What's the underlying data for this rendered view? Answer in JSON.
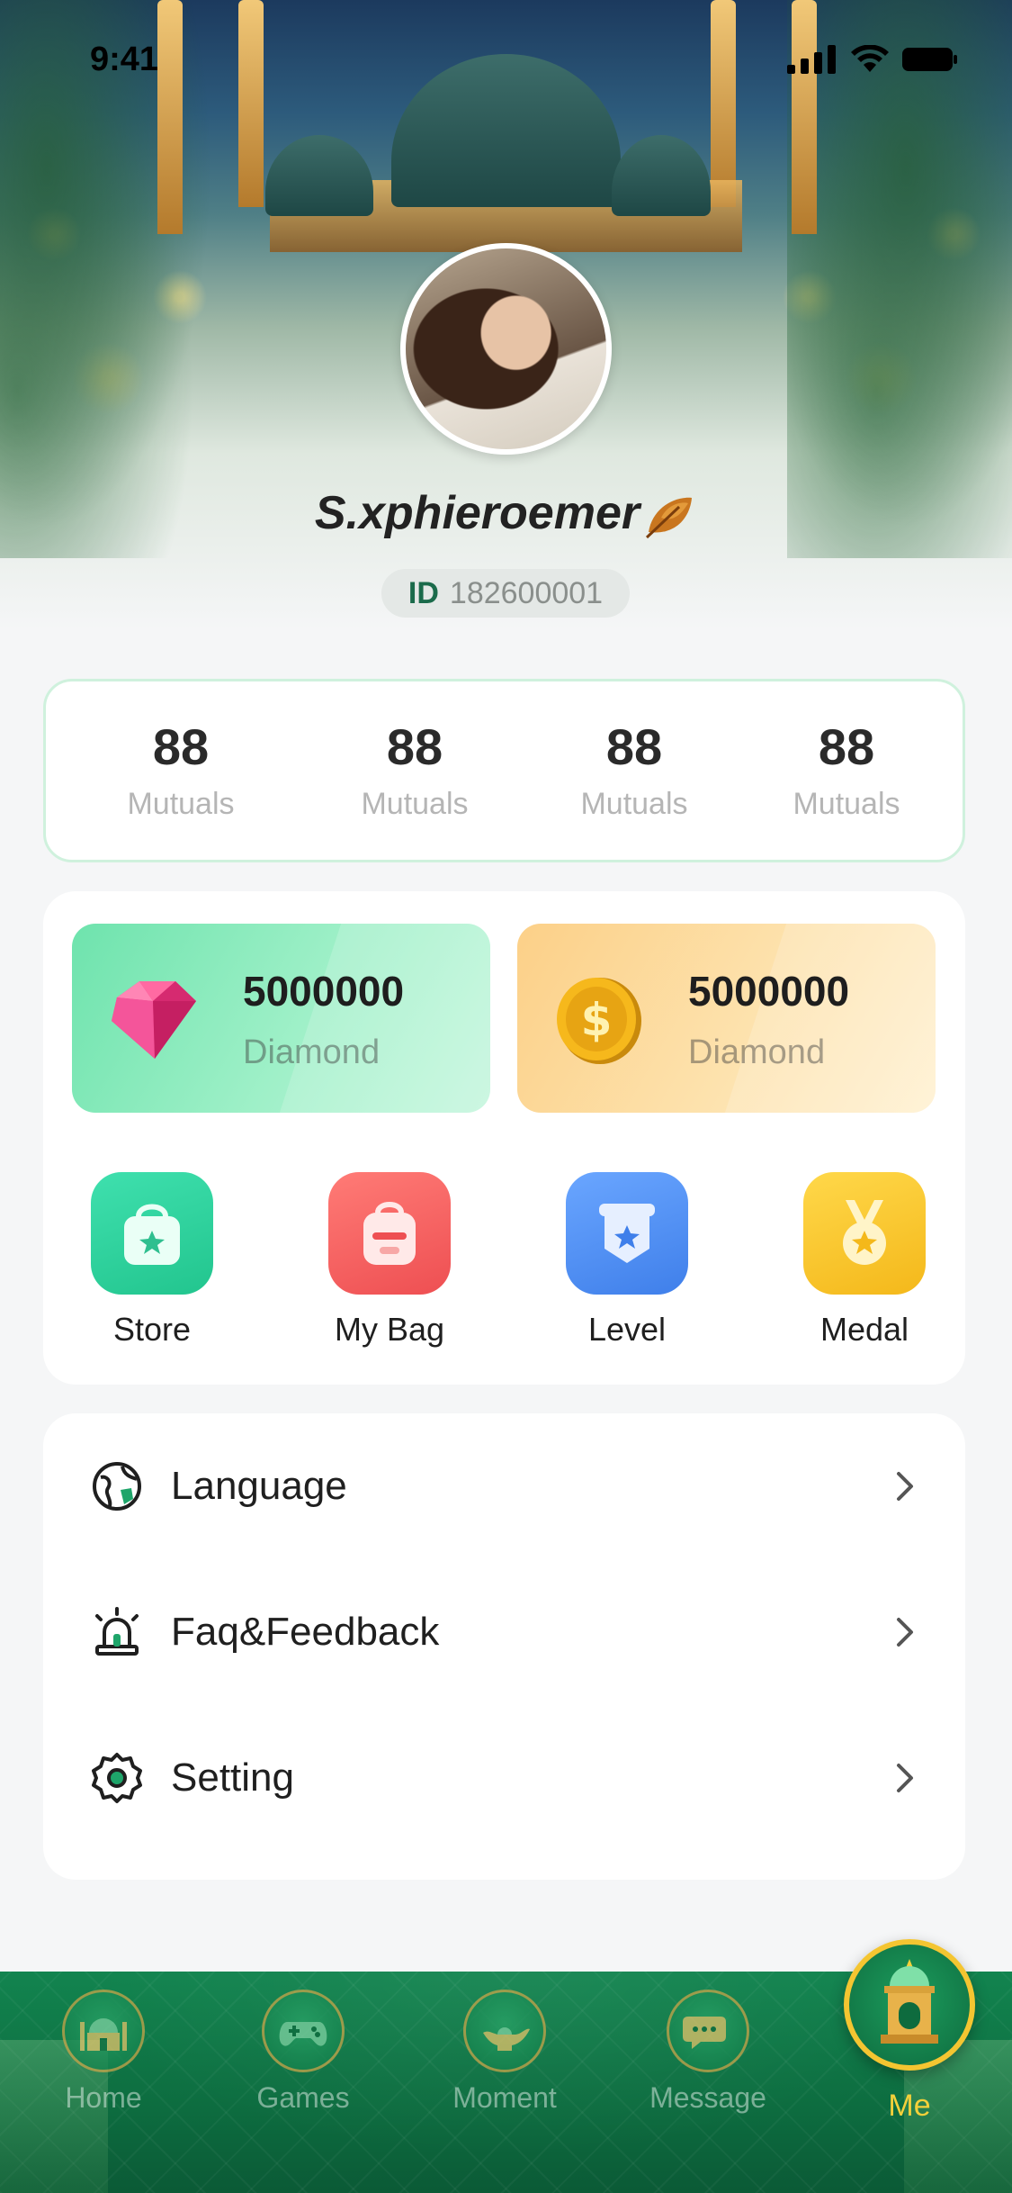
{
  "status_bar": {
    "time": "9:41"
  },
  "profile": {
    "username": "S.xphieroemer",
    "id_label": "ID",
    "id_value": "182600001"
  },
  "stats": [
    {
      "value": "88",
      "label": "Mutuals"
    },
    {
      "value": "88",
      "label": "Mutuals"
    },
    {
      "value": "88",
      "label": "Mutuals"
    },
    {
      "value": "88",
      "label": "Mutuals"
    }
  ],
  "wallet": [
    {
      "icon": "diamond-icon",
      "value": "5000000",
      "label": "Diamond"
    },
    {
      "icon": "coin-icon",
      "value": "5000000",
      "label": "Diamond"
    }
  ],
  "shortcuts": [
    {
      "icon": "store-bag-icon",
      "label": "Store",
      "color": "#2fd3a0"
    },
    {
      "icon": "backpack-icon",
      "label": "My Bag",
      "color": "#f3625f"
    },
    {
      "icon": "level-badge-icon",
      "label": "Level",
      "color": "#4f8ff1"
    },
    {
      "icon": "medal-icon",
      "label": "Medal",
      "color": "#f6c51b"
    }
  ],
  "menu": [
    {
      "icon": "globe-icon",
      "label": "Language"
    },
    {
      "icon": "alarm-light-icon",
      "label": "Faq&Feedback"
    },
    {
      "icon": "gear-icon",
      "label": "Setting"
    }
  ],
  "nav": {
    "items": [
      {
        "icon": "mosque-icon",
        "label": "Home"
      },
      {
        "icon": "gamepad-icon",
        "label": "Games"
      },
      {
        "icon": "magic-lamp-icon",
        "label": "Moment"
      },
      {
        "icon": "chat-bubble-icon",
        "label": "Message"
      }
    ],
    "active": {
      "icon": "lantern-icon",
      "label": "Me"
    }
  },
  "colors": {
    "accent_green": "#0f7a47",
    "active_gold": "#f4d03a",
    "id_green": "#1b6b4b"
  }
}
